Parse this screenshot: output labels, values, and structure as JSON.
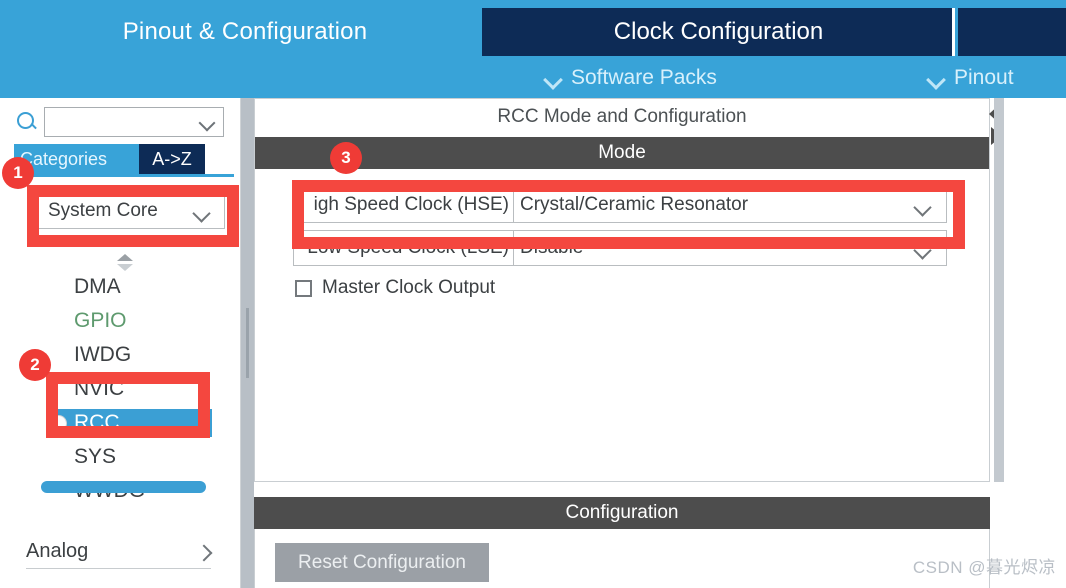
{
  "header": {
    "tabs": [
      {
        "label": "Pinout & Configuration",
        "active": false
      },
      {
        "label": "Clock Configuration",
        "active": true
      }
    ],
    "dropdowns": [
      {
        "label": "Software Packs",
        "icon": "chevron-down-icon"
      },
      {
        "label": "Pinout",
        "icon": "chevron-down-icon"
      }
    ],
    "colors": {
      "light_blue": "#38a3d8",
      "dark_navy": "#0d2b56",
      "text": "#ffffff"
    }
  },
  "sidebar": {
    "search": {
      "value": "",
      "placeholder": "",
      "icon": "search-icon",
      "chevron": "chevron-down-icon"
    },
    "view_tabs": [
      {
        "label": "Categories",
        "active": true
      },
      {
        "label": "A->Z",
        "active": false
      }
    ],
    "category_select": {
      "value": "System Core",
      "chevron": "chevron-down-icon"
    },
    "peripherals": [
      {
        "label": "DMA",
        "state": "normal"
      },
      {
        "label": "GPIO",
        "state": "configured"
      },
      {
        "label": "IWDG",
        "state": "normal"
      },
      {
        "label": "NVIC",
        "state": "normal"
      },
      {
        "label": "RCC",
        "state": "selected"
      },
      {
        "label": "SYS",
        "state": "normal"
      },
      {
        "label": "WWDG",
        "state": "normal"
      }
    ],
    "footer_group": {
      "label": "Analog",
      "chevron": "chevron-right-icon"
    }
  },
  "main": {
    "panel_title": "RCC Mode and Configuration",
    "mode_section_title": "Mode",
    "clock_rows": [
      {
        "label": "igh Speed Clock (HSE)",
        "value": "Crystal/Ceramic Resonator",
        "chevron": "chevron-down-icon"
      },
      {
        "label": "Low Speed Clock (LSE)",
        "value": "Disable",
        "chevron": "chevron-down-icon"
      }
    ],
    "checkbox": {
      "label": "Master Clock Output",
      "checked": false
    },
    "config_section_title": "Configuration",
    "reset_button_label": "Reset Configuration"
  },
  "annotations": {
    "color": "#f4473f",
    "badges": [
      {
        "number": "1",
        "target": "System Core category selector"
      },
      {
        "number": "2",
        "target": "RCC peripheral entry"
      },
      {
        "number": "3",
        "target": "High Speed Clock HSE mode dropdown"
      }
    ]
  },
  "watermark": {
    "text": "CSDN @暮光烬凉"
  }
}
